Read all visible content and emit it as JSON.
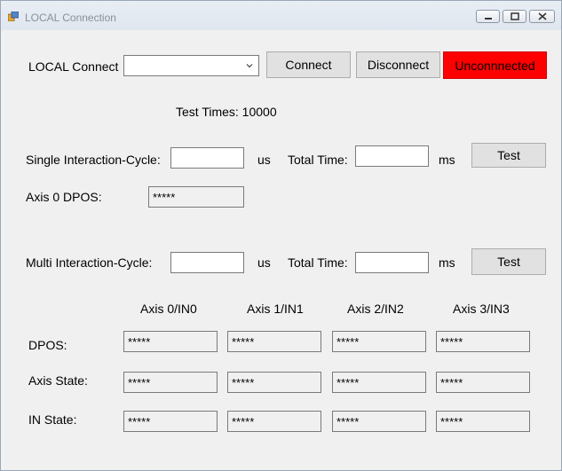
{
  "window": {
    "title": "LOCAL Connection"
  },
  "connection": {
    "label": "LOCAL Connect",
    "combo_value": "",
    "connect_label": "Connect",
    "disconnect_label": "Disconnect",
    "status_label": "Unconnnected",
    "status_color": "#ff0000"
  },
  "test_times": "Test Times: 10000",
  "single": {
    "label": "Single Interaction-Cycle:",
    "cycle_value": "",
    "cycle_unit": "us",
    "total_label": "Total Time:",
    "total_value": "",
    "total_unit": "ms",
    "test_label": "Test",
    "dpos_label": "Axis 0 DPOS:",
    "dpos_value": "*****"
  },
  "multi": {
    "label": "Multi Interaction-Cycle:",
    "cycle_value": "",
    "cycle_unit": "us",
    "total_label": "Total Time:",
    "total_value": "",
    "total_unit": "ms",
    "test_label": "Test"
  },
  "grid": {
    "columns": [
      "Axis 0/IN0",
      "Axis 1/IN1",
      "Axis 2/IN2",
      "Axis 3/IN3"
    ],
    "rows": [
      {
        "label": "DPOS:",
        "values": [
          "*****",
          "*****",
          "*****",
          "*****"
        ]
      },
      {
        "label": "Axis State:",
        "values": [
          "*****",
          "*****",
          "*****",
          "*****"
        ]
      },
      {
        "label": "IN State:",
        "values": [
          "*****",
          "*****",
          "*****",
          "*****"
        ]
      }
    ]
  }
}
